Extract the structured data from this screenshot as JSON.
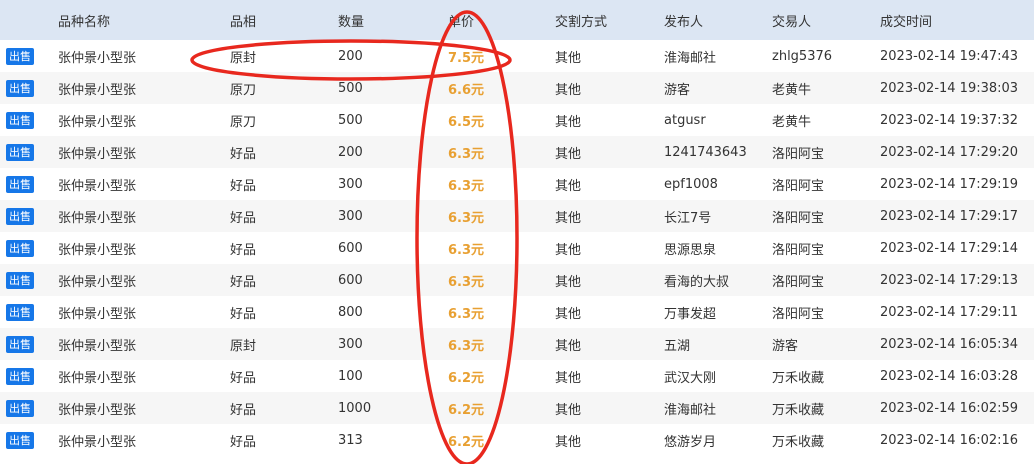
{
  "table": {
    "headers": [
      "",
      "品种名称",
      "品相",
      "数量",
      "单价",
      "交割方式",
      "发布人",
      "交易人",
      "成交时间"
    ],
    "rows": [
      {
        "type": "出售",
        "name": "张仲景小型张",
        "grade": "原封",
        "qty": "200",
        "price": "7.5元",
        "delivery": "其他",
        "publisher": "淮海邮社",
        "trader": "zhlg5376",
        "time": "2023-02-14 19:47:43"
      },
      {
        "type": "出售",
        "name": "张仲景小型张",
        "grade": "原刀",
        "qty": "500",
        "price": "6.6元",
        "delivery": "其他",
        "publisher": "游客",
        "trader": "老黄牛",
        "time": "2023-02-14 19:38:03"
      },
      {
        "type": "出售",
        "name": "张仲景小型张",
        "grade": "原刀",
        "qty": "500",
        "price": "6.5元",
        "delivery": "其他",
        "publisher": "atgusr",
        "trader": "老黄牛",
        "time": "2023-02-14 19:37:32"
      },
      {
        "type": "出售",
        "name": "张仲景小型张",
        "grade": "好品",
        "qty": "200",
        "price": "6.3元",
        "delivery": "其他",
        "publisher": "1241743643",
        "trader": "洛阳阿宝",
        "time": "2023-02-14 17:29:20"
      },
      {
        "type": "出售",
        "name": "张仲景小型张",
        "grade": "好品",
        "qty": "300",
        "price": "6.3元",
        "delivery": "其他",
        "publisher": "epf1008",
        "trader": "洛阳阿宝",
        "time": "2023-02-14 17:29:19"
      },
      {
        "type": "出售",
        "name": "张仲景小型张",
        "grade": "好品",
        "qty": "300",
        "price": "6.3元",
        "delivery": "其他",
        "publisher": "长江7号",
        "trader": "洛阳阿宝",
        "time": "2023-02-14 17:29:17"
      },
      {
        "type": "出售",
        "name": "张仲景小型张",
        "grade": "好品",
        "qty": "600",
        "price": "6.3元",
        "delivery": "其他",
        "publisher": "思源思泉",
        "trader": "洛阳阿宝",
        "time": "2023-02-14 17:29:14"
      },
      {
        "type": "出售",
        "name": "张仲景小型张",
        "grade": "好品",
        "qty": "600",
        "price": "6.3元",
        "delivery": "其他",
        "publisher": "看海的大叔",
        "trader": "洛阳阿宝",
        "time": "2023-02-14 17:29:13"
      },
      {
        "type": "出售",
        "name": "张仲景小型张",
        "grade": "好品",
        "qty": "800",
        "price": "6.3元",
        "delivery": "其他",
        "publisher": "万事发超",
        "trader": "洛阳阿宝",
        "time": "2023-02-14 17:29:11"
      },
      {
        "type": "出售",
        "name": "张仲景小型张",
        "grade": "原封",
        "qty": "300",
        "price": "6.3元",
        "delivery": "其他",
        "publisher": "五湖",
        "trader": "游客",
        "time": "2023-02-14 16:05:34"
      },
      {
        "type": "出售",
        "name": "张仲景小型张",
        "grade": "好品",
        "qty": "100",
        "price": "6.2元",
        "delivery": "其他",
        "publisher": "武汉大刚",
        "trader": "万禾收藏",
        "time": "2023-02-14 16:03:28"
      },
      {
        "type": "出售",
        "name": "张仲景小型张",
        "grade": "好品",
        "qty": "1000",
        "price": "6.2元",
        "delivery": "其他",
        "publisher": "淮海邮社",
        "trader": "万禾收藏",
        "time": "2023-02-14 16:02:59"
      },
      {
        "type": "出售",
        "name": "张仲景小型张",
        "grade": "好品",
        "qty": "313",
        "price": "6.2元",
        "delivery": "其他",
        "publisher": "悠游岁月",
        "trader": "万禾收藏",
        "time": "2023-02-14 16:02:16"
      }
    ]
  },
  "colors": {
    "header_bg": "#dce6f3",
    "badge_bg": "#1677e8",
    "price": "#e8a032",
    "annotation": "#e8281e"
  }
}
